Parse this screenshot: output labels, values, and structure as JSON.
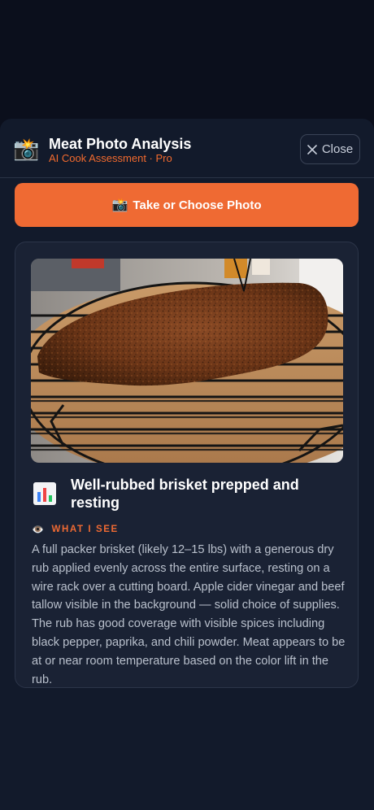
{
  "header": {
    "icon": "camera-flash-icon",
    "title": "Meat Photo Analysis",
    "subtitle": "AI Cook Assessment · Pro",
    "close_label": "Close"
  },
  "photo_button": {
    "icon": "camera-flash-icon",
    "label": "Take or Choose Photo"
  },
  "analysis": {
    "photo_subject": "brisket-on-wire-rack",
    "verdict_icon": "bar-chart-icon",
    "verdict_title": "Well-rubbed brisket prepped and resting",
    "section_icon": "eye-icon",
    "section_label": "WHAT I SEE",
    "section_text": "A full packer brisket (likely 12–15 lbs) with a generous dry rub applied evenly across the entire surface, resting on a wire rack over a cutting board. Apple cider vinegar and beef tallow visible in the background — solid choice of supplies. The rub has good coverage with visible spices including black pepper, paprika, and chili powder. Meat appears to be at or near room temperature based on the color lift in the rub."
  },
  "colors": {
    "accent": "#ef6a33",
    "background": "#0b0f1c",
    "sheet": "#121a2b",
    "card": "#1a2234"
  }
}
